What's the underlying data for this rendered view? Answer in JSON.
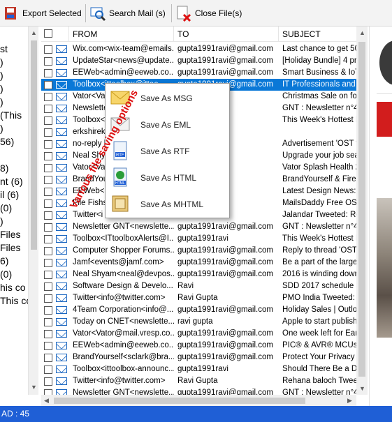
{
  "toolbar": {
    "export_label": "Export Selected",
    "search_label": "Search Mail (s)",
    "close_label": "Close File(s)"
  },
  "left_tree": [
    "st",
    ")",
    ")",
    ")",
    ")",
    "(This",
    ")",
    "56)",
    "",
    "8)",
    "nt (6)",
    "il (6)",
    "(0)",
    ")",
    " Files",
    " Files",
    "6)",
    "(0)",
    "his co",
    "This co"
  ],
  "columns": {
    "from": "FROM",
    "to": "TO",
    "subject": "SUBJECT"
  },
  "rows": [
    {
      "from": "Wix.com<wix-team@emails...",
      "to": "gupta1991ravi@gmail.com",
      "subject": "Last chance to get 50"
    },
    {
      "from": "UpdateStar<news@update...",
      "to": "gupta1991ravi@gmail.com",
      "subject": "[Holiday Bundle] 4 pro"
    },
    {
      "from": "EEWeb<admin@eeweb.co...",
      "to": "gupta1991ravi@gmail.com",
      "subject": "Smart Business & IoT-"
    },
    {
      "from": "Toolbox<ittoolbox@ittoo...",
      "to": "gupta1991ravi@gmail.com",
      "subject": "IT Professionals and L"
    },
    {
      "from": "Vator<Vat",
      "to": "",
      "subject": "Christmas Sale on for V"
    },
    {
      "from": "Newslette",
      "to": "",
      "subject": "GNT : Newsletter n°49"
    },
    {
      "from": "Toolbox<",
      "to": "",
      "subject": "This Week's Hottest IT"
    },
    {
      "from": "erkshireki",
      "to": "gmail.com",
      "subject": ""
    },
    {
      "from": "no-reply h",
      "to": "",
      "subject": "Advertisement 'OST to"
    },
    {
      "from": "Neal Shya",
      "to": "",
      "subject": "Upgrade your job sear"
    },
    {
      "from": "Vator<Vat",
      "to": "",
      "subject": "Vator Splash Health 20"
    },
    {
      "from": "BrandYou",
      "to": "",
      "subject": "BrandYourself & Firehc"
    },
    {
      "from": "EEWeb<a",
      "to": "",
      "subject": "Latest Design News: N"
    },
    {
      "from": "File Fishst",
      "to": "",
      "subject": "MailsDaddy Free OST"
    },
    {
      "from": "Twitter<i",
      "to": "",
      "subject": "Jalandar Tweeted: Ro"
    },
    {
      "from": "Newsletter GNT<newslette...",
      "to": "gupta1991ravi@gmail.com",
      "subject": "GNT : Newsletter n°49"
    },
    {
      "from": "Toolbox<ITtoolboxAlerts@I...",
      "to": "gupta1991ravi",
      "subject": "This Week's Hottest IT"
    },
    {
      "from": "Computer Shopper Forums...",
      "to": "gupta1991ravi@gmail.com",
      "subject": "Reply to thread 'OST to"
    },
    {
      "from": "Jamf<events@jamf.com>",
      "to": "gupta1991ravi@gmail.com",
      "subject": "Be a part of the largest"
    },
    {
      "from": "Neal Shyam<neal@devpos...",
      "to": "gupta1991ravi@gmail.com",
      "subject": "2016 is winding down,"
    },
    {
      "from": "Software Design & Develo...",
      "to": "Ravi",
      "subject": "SDD 2017 schedule &"
    },
    {
      "from": "Twitter<info@twitter.com>",
      "to": "Ravi Gupta",
      "subject": "PMO India Tweeted: C"
    },
    {
      "from": "4Team Corporation<info@...",
      "to": "gupta1991ravi@gmail.com",
      "subject": "Holiday Sales | Outlook"
    },
    {
      "from": "Today on CNET<newslette...",
      "to": "ravi gupta",
      "subject": "Apple to start publishin"
    },
    {
      "from": "Vator<Vator@mail.vresp.co...",
      "to": "gupta1991ravi@gmail.com",
      "subject": "One week left for Early"
    },
    {
      "from": "EEWeb<admin@eeweb.co...",
      "to": "gupta1991ravi@gmail.com",
      "subject": "PIC® & AVR® MCUs -"
    },
    {
      "from": "BrandYourself<sclark@bra...",
      "to": "gupta1991ravi@gmail.com",
      "subject": "Protect Your Privacy |"
    },
    {
      "from": "Toolbox<ittoolbox-announc...",
      "to": "gupta1991ravi",
      "subject": "Should There Be a Dri"
    },
    {
      "from": "Twitter<info@twitter.com>",
      "to": "Ravi Gupta",
      "subject": "Rehana baloch Tweet"
    },
    {
      "from": "Newsletter GNT<newslette...",
      "to": "gupta1991ravi@gmail.com",
      "subject": "GNT : Newsletter n°49"
    }
  ],
  "selected_row": 3,
  "context_menu": [
    {
      "label": "Save As MSG",
      "icon": "envelope-gold-icon"
    },
    {
      "label": "Save As EML",
      "icon": "envelope-grey-icon"
    },
    {
      "label": "Save As RTF",
      "icon": "rtf-document-icon"
    },
    {
      "label": "Save As HTML",
      "icon": "html-document-icon"
    },
    {
      "label": "Save As MHTML",
      "icon": "mhtml-document-icon"
    }
  ],
  "annotation": "Various file saving options",
  "status": "AD : 45",
  "colors": {
    "selection": "#0a78d7",
    "status_bar": "#1f5fd6",
    "annotation": "#dd1111"
  }
}
